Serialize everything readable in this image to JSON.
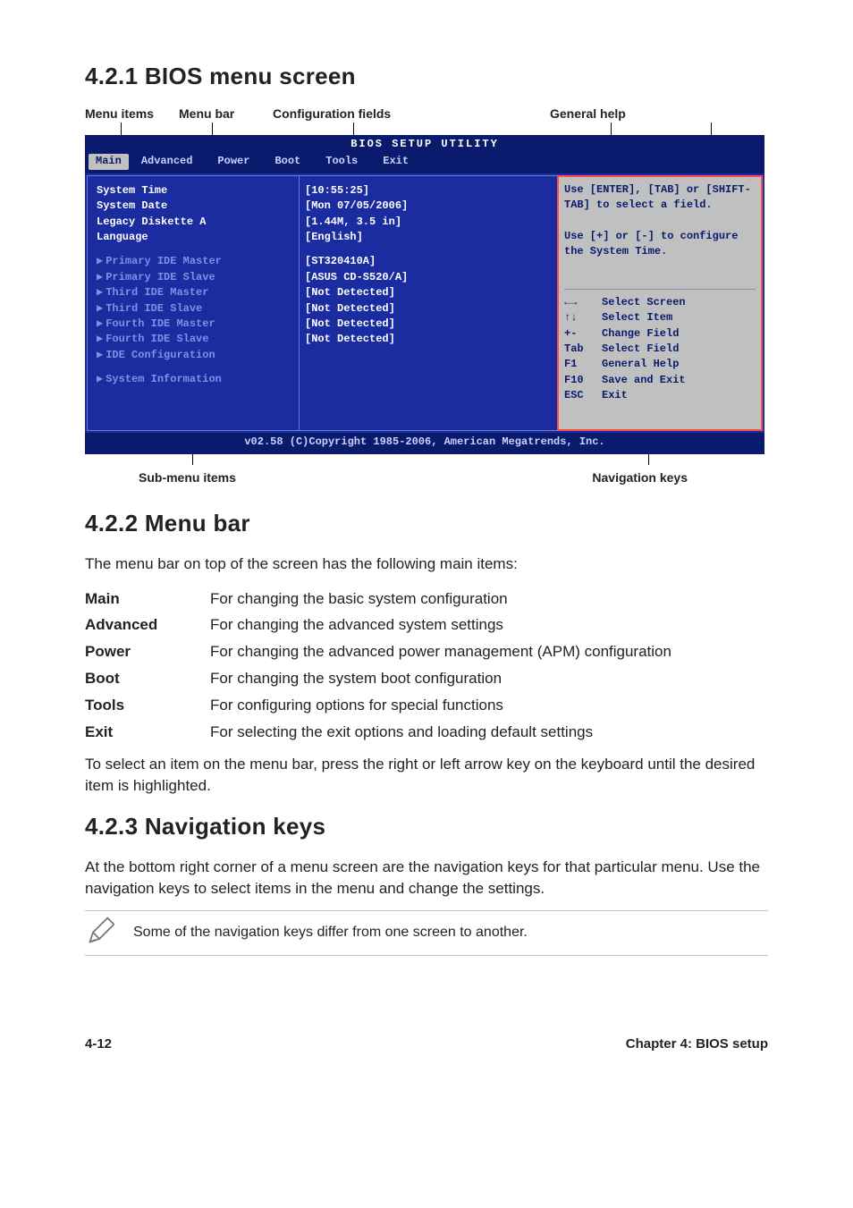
{
  "section_421_title": "4.2.1   BIOS menu screen",
  "annotations_top": {
    "menu_items": "Menu items",
    "menu_bar": "Menu bar",
    "config_fields": "Configuration fields",
    "general_help": "General help"
  },
  "annotations_bottom": {
    "sub_menu_items": "Sub-menu items",
    "nav_keys": "Navigation keys"
  },
  "bios": {
    "title": "BIOS SETUP UTILITY",
    "tabs": [
      "Main",
      "Advanced",
      "Power",
      "Boot",
      "Tools",
      "Exit"
    ],
    "selected_tab": "Main",
    "left_top": [
      "System Time",
      "System Date",
      "Legacy Diskette A",
      "Language"
    ],
    "left_sub": [
      "Primary IDE Master",
      "Primary IDE Slave",
      "Third IDE Master",
      "Third IDE Slave",
      "Fourth IDE Master",
      "Fourth IDE Slave",
      "IDE Configuration"
    ],
    "left_sysinfo": "System Information",
    "mid_top": [
      "[10:55:25]",
      "[Mon 07/05/2006]",
      "[1.44M, 3.5 in]",
      "[English]"
    ],
    "mid_sub": [
      "[ST320410A]",
      "[ASUS CD-S520/A]",
      "[Not Detected]",
      "[Not Detected]",
      "[Not Detected]",
      "[Not Detected]"
    ],
    "help_top": "Use [ENTER], [TAB] or [SHIFT-TAB] to select a field.\n\nUse [+] or [-] to configure the System Time.",
    "nav": [
      {
        "k": "←→",
        "v": "Select Screen"
      },
      {
        "k": "↑↓",
        "v": "Select Item"
      },
      {
        "k": "+-",
        "v": "Change Field"
      },
      {
        "k": "Tab",
        "v": "Select Field"
      },
      {
        "k": "F1",
        "v": "General Help"
      },
      {
        "k": "F10",
        "v": "Save and Exit"
      },
      {
        "k": "ESC",
        "v": "Exit"
      }
    ],
    "footer": "v02.58 (C)Copyright 1985-2006, American Megatrends, Inc."
  },
  "section_422_title": "4.2.2   Menu bar",
  "section_422_intro": "The menu bar on top of the screen has the following main items:",
  "menu_defs": [
    {
      "k": "Main",
      "v": "For changing the basic system configuration"
    },
    {
      "k": "Advanced",
      "v": "For changing the advanced system settings"
    },
    {
      "k": "Power",
      "v": "For changing the advanced power management (APM) configuration"
    },
    {
      "k": "Boot",
      "v": "For changing the system boot configuration"
    },
    {
      "k": "Tools",
      "v": "For configuring options for special functions"
    },
    {
      "k": "Exit",
      "v": "For selecting the exit options and loading default settings"
    }
  ],
  "section_422_outro": "To select an item on the menu bar, press the right or left arrow key on the keyboard until the desired item is highlighted.",
  "section_423_title": "4.2.3   Navigation keys",
  "section_423_body": "At the bottom right corner of a menu screen are the navigation keys for that particular menu. Use the navigation keys to select items in the menu and change the settings.",
  "note_text": "Some of the navigation keys differ from one screen to another.",
  "footer_left": "4-12",
  "footer_right": "Chapter 4: BIOS setup"
}
